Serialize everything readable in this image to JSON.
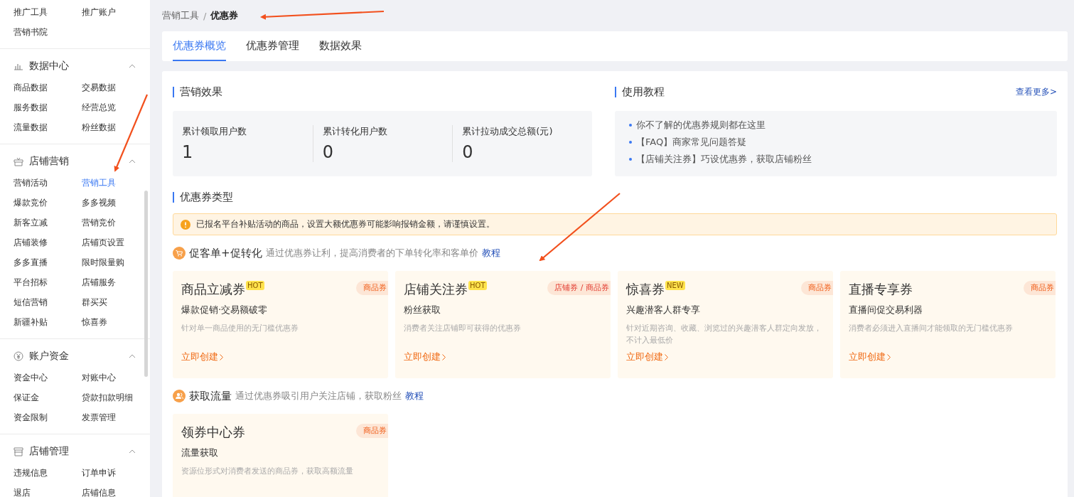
{
  "sidebar": {
    "sections": [
      {
        "items": [
          {
            "label": "推广工具",
            "selected": false
          },
          {
            "label": "推广账户",
            "selected": false
          },
          {
            "label": "营销书院",
            "selected": false
          }
        ]
      },
      {
        "title": "数据中心",
        "expanded": true,
        "items": [
          {
            "label": "商品数据",
            "selected": false
          },
          {
            "label": "交易数据",
            "selected": false
          },
          {
            "label": "服务数据",
            "selected": false
          },
          {
            "label": "经营总览",
            "selected": false
          },
          {
            "label": "流量数据",
            "selected": false
          },
          {
            "label": "粉丝数据",
            "selected": false
          }
        ]
      },
      {
        "title": "店铺营销",
        "expanded": true,
        "items": [
          {
            "label": "营销活动",
            "selected": false
          },
          {
            "label": "营销工具",
            "selected": true
          },
          {
            "label": "爆款竞价",
            "selected": false
          },
          {
            "label": "多多视频",
            "selected": false
          },
          {
            "label": "新客立减",
            "selected": false
          },
          {
            "label": "营销竞价",
            "selected": false
          },
          {
            "label": "店铺装修",
            "selected": false
          },
          {
            "label": "店铺页设置",
            "selected": false
          },
          {
            "label": "多多直播",
            "selected": false
          },
          {
            "label": "限时限量购",
            "selected": false
          },
          {
            "label": "平台招标",
            "selected": false
          },
          {
            "label": "店铺服务",
            "selected": false
          },
          {
            "label": "短信营销",
            "selected": false
          },
          {
            "label": "群买买",
            "selected": false
          },
          {
            "label": "新疆补贴",
            "selected": false
          },
          {
            "label": "惊喜券",
            "selected": false
          }
        ]
      },
      {
        "title": "账户资金",
        "expanded": true,
        "items": [
          {
            "label": "资金中心",
            "selected": false
          },
          {
            "label": "对账中心",
            "selected": false
          },
          {
            "label": "保证金",
            "selected": false
          },
          {
            "label": "贷款扣款明细",
            "selected": false
          },
          {
            "label": "资金限制",
            "selected": false
          },
          {
            "label": "发票管理",
            "selected": false
          }
        ]
      },
      {
        "title": "店铺管理",
        "expanded": true,
        "items": [
          {
            "label": "违规信息",
            "selected": false
          },
          {
            "label": "订单申诉",
            "selected": false
          },
          {
            "label": "退店",
            "selected": false
          },
          {
            "label": "店铺信息",
            "selected": false
          }
        ]
      }
    ]
  },
  "breadcrumb": {
    "separator": "/",
    "items": [
      "营销工具",
      "优惠券"
    ]
  },
  "tabs": [
    {
      "label": "优惠券概览",
      "selected": true
    },
    {
      "label": "优惠券管理",
      "selected": false
    },
    {
      "label": "数据效果",
      "selected": false
    }
  ],
  "effect": {
    "title": "营销效果",
    "stats": [
      {
        "label": "累计领取用户数",
        "value": "1"
      },
      {
        "label": "累计转化用户数",
        "value": "0"
      },
      {
        "label": "累计拉动成交总额(元)",
        "value": "0"
      }
    ]
  },
  "tutorial": {
    "title": "使用教程",
    "more": "查看更多>",
    "items": [
      "你不了解的优惠券规则都在这里",
      "【FAQ】商家常见问题答疑",
      "【店铺关注券】巧设优惠券，获取店铺粉丝"
    ]
  },
  "types": {
    "title": "优惠券类型",
    "alert": "已报名平台补贴活动的商品，设置大额优惠券可能影响报销金额，请谨慎设置。",
    "groups": [
      {
        "title": "促客单+促转化",
        "desc": "通过优惠券让利，提高消费者的下单转化率和客单价",
        "link": "教程",
        "cards": [
          {
            "title": "商品立减券",
            "badge": "HOT",
            "tag": "商品券",
            "subtitle": "爆款促销·交易额破零",
            "desc": "针对单一商品使用的无门槛优惠券",
            "action": "立即创建"
          },
          {
            "title": "店铺关注券",
            "badge": "HOT",
            "tag": "店铺券 / 商品券",
            "subtitle": "粉丝获取",
            "desc": "消费者关注店铺即可获得的优惠券",
            "action": "立即创建"
          },
          {
            "title": "惊喜券",
            "badge": "NEW",
            "tag": "商品券",
            "subtitle": "兴趣潜客人群专享",
            "desc": "针对近期咨询、收藏、浏览过的兴趣潜客人群定向发放，不计入最低价",
            "action": "立即创建"
          },
          {
            "title": "直播专享券",
            "tag": "商品券",
            "subtitle": "直播间促交易利器",
            "desc": "消费者必须进入直播间才能领取的无门槛优惠券",
            "action": "立即创建"
          }
        ]
      },
      {
        "title": "获取流量",
        "desc": "通过优惠券吸引用户关注店铺，获取粉丝",
        "link": "教程",
        "cards": [
          {
            "title": "领券中心券",
            "tag": "商品券",
            "subtitle": "流量获取",
            "desc": "资源位形式对消费者发送的商品券，获取高额流量"
          }
        ]
      }
    ]
  }
}
